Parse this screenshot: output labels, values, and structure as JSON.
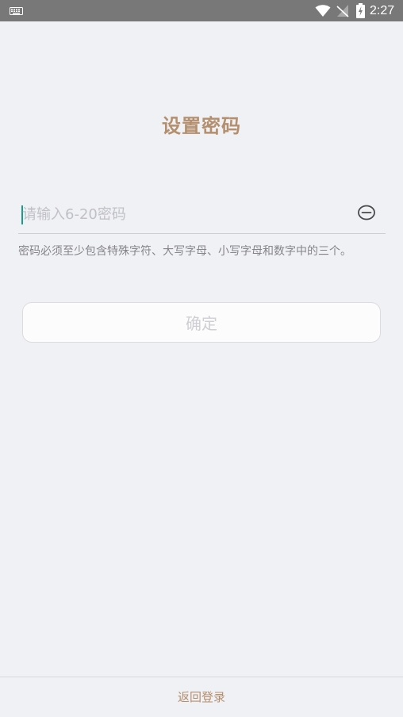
{
  "status_bar": {
    "time": "2:27",
    "icons": [
      "keyboard-icon",
      "wifi-icon",
      "no-signal-icon",
      "battery-charging-icon"
    ]
  },
  "page": {
    "title": "设置密码"
  },
  "password_field": {
    "value": "",
    "placeholder": "请输入6-20密码",
    "toggle_icon": "eye-icon"
  },
  "hint": "密码必须至少包含特殊字符、大写字母、小写字母和数字中的三个。",
  "confirm_button": {
    "label": "确定",
    "enabled": false
  },
  "footer": {
    "back_login_label": "返回登录"
  },
  "colors": {
    "accent": "#b48f6e",
    "background": "#f0f1f5",
    "status_bar": "#787878",
    "cursor": "#1a9a8a"
  }
}
